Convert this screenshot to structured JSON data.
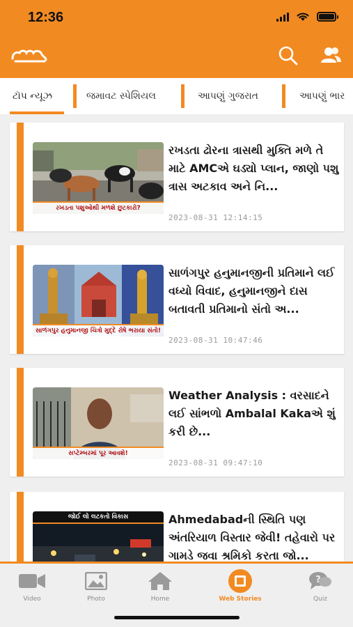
{
  "status_bar": {
    "time": "12:36"
  },
  "app": {
    "logo_text": "જમાવટ"
  },
  "tabs": [
    {
      "label": "ટૉપ ન્યૂઝ"
    },
    {
      "label": "જમાવટ સ્પેશિયલ"
    },
    {
      "label": "આપણું ગુજરાત"
    },
    {
      "label": "આપણું ભાર"
    }
  ],
  "articles": [
    {
      "headline": "રખડતા ઢોરના ત્રાસથી મુક્તિ મળે તે માટે AMCએ ઘડ્યો પ્લાન, જાણો પશુ ત્રાસ અટકાવ અને નિ...",
      "timestamp": "2023-08-31 12:14:15",
      "thumb_caption": "રખડતા પશુઓથી મળશે છુટકારો?"
    },
    {
      "headline": "સાળંગપુર હનુમાનજીની પ્રતિમાને લઈ વધ્યો વિવાદ, હનુમાનજીને દાસ બતાવતી પ્રતિમાનો સંતો અ...",
      "timestamp": "2023-08-31 10:47:46",
      "thumb_caption": "સાળંગપુર હનુમાનજી ચિત્રો મુદ્દે રોષે ભરાયા સંતો!"
    },
    {
      "headline": "Weather Analysis : વરસાદને લઈ સાંભળો Ambalal Kakaએ શું કરી છે...",
      "timestamp": "2023-08-31 09:47:10",
      "thumb_caption": "સપ્ટેમ્બરમાં પૂર આવશે!"
    },
    {
      "headline": "Ahmedabadની સ્થિતિ પણ અંતરિયાળ વિસ્તાર જેવી! તહેવારો પર ગામડે જવા શ્રમિકો કરતા જો...",
      "timestamp": "",
      "thumb_caption": "જોઈ લો લટકતો વિકાસ"
    }
  ],
  "bottom_nav": [
    {
      "label": "Video",
      "icon": "video-camera-icon"
    },
    {
      "label": "Photo",
      "icon": "photo-icon"
    },
    {
      "label": "Home",
      "icon": "home-icon"
    },
    {
      "label": "Web Stories",
      "icon": "web-stories-icon",
      "active": true
    },
    {
      "label": "Quiz",
      "icon": "quiz-icon"
    }
  ],
  "colors": {
    "accent": "#f28a22",
    "background": "#efefef",
    "card": "#ffffff"
  }
}
